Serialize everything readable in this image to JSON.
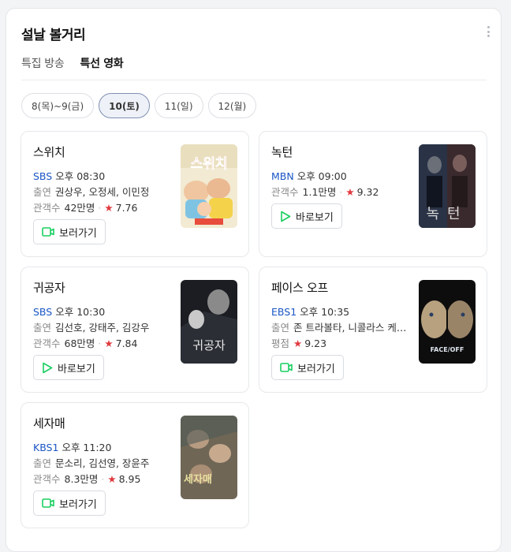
{
  "panel": {
    "title": "설날 볼거리"
  },
  "subtabs": [
    {
      "label": "특집 방송",
      "active": false
    },
    {
      "label": "특선 영화",
      "active": true
    }
  ],
  "dates": [
    {
      "label": "8(목)~9(금)",
      "active": false
    },
    {
      "label": "10(토)",
      "active": true
    },
    {
      "label": "11(일)",
      "active": false
    },
    {
      "label": "12(월)",
      "active": false
    }
  ],
  "cards": [
    {
      "title": "스위치",
      "channel": "SBS",
      "time": "오후 08:30",
      "cast_label": "출연",
      "cast": "권상우, 오정세, 이민정",
      "stat_label": "관객수",
      "stat": "42만명",
      "rating": "7.76",
      "button": "보러가기",
      "button_icon": "tv-icon",
      "poster_title": "스위치"
    },
    {
      "title": "녹턴",
      "channel": "MBN",
      "time": "오후 09:00",
      "cast_label": "",
      "cast": "",
      "stat_label": "관객수",
      "stat": "1.1만명",
      "rating": "9.32",
      "button": "바로보기",
      "button_icon": "play-icon",
      "poster_title": "녹턴"
    },
    {
      "title": "귀공자",
      "channel": "SBS",
      "time": "오후 10:30",
      "cast_label": "출연",
      "cast": "김선호, 강태주, 김강우",
      "stat_label": "관객수",
      "stat": "68만명",
      "rating": "7.84",
      "button": "바로보기",
      "button_icon": "play-icon",
      "poster_title": "귀공자"
    },
    {
      "title": "페이스 오프",
      "channel": "EBS1",
      "time": "오후 10:35",
      "cast_label": "출연",
      "cast": "존 트라볼타, 니콜라스 케이지",
      "stat_label": "평점",
      "stat": "",
      "rating": "9.23",
      "button": "보러가기",
      "button_icon": "tv-icon",
      "poster_title": "FACE/OFF"
    },
    {
      "title": "세자매",
      "channel": "KBS1",
      "time": "오후 11:20",
      "cast_label": "출연",
      "cast": "문소리, 김선영, 장윤주",
      "stat_label": "관객수",
      "stat": "8.3만명",
      "rating": "8.95",
      "button": "보러가기",
      "button_icon": "tv-icon",
      "poster_title": "세자매"
    }
  ],
  "colors": {
    "channel": "#1a56c4",
    "star": "#e0393e",
    "button_icon": "#19ce60"
  }
}
